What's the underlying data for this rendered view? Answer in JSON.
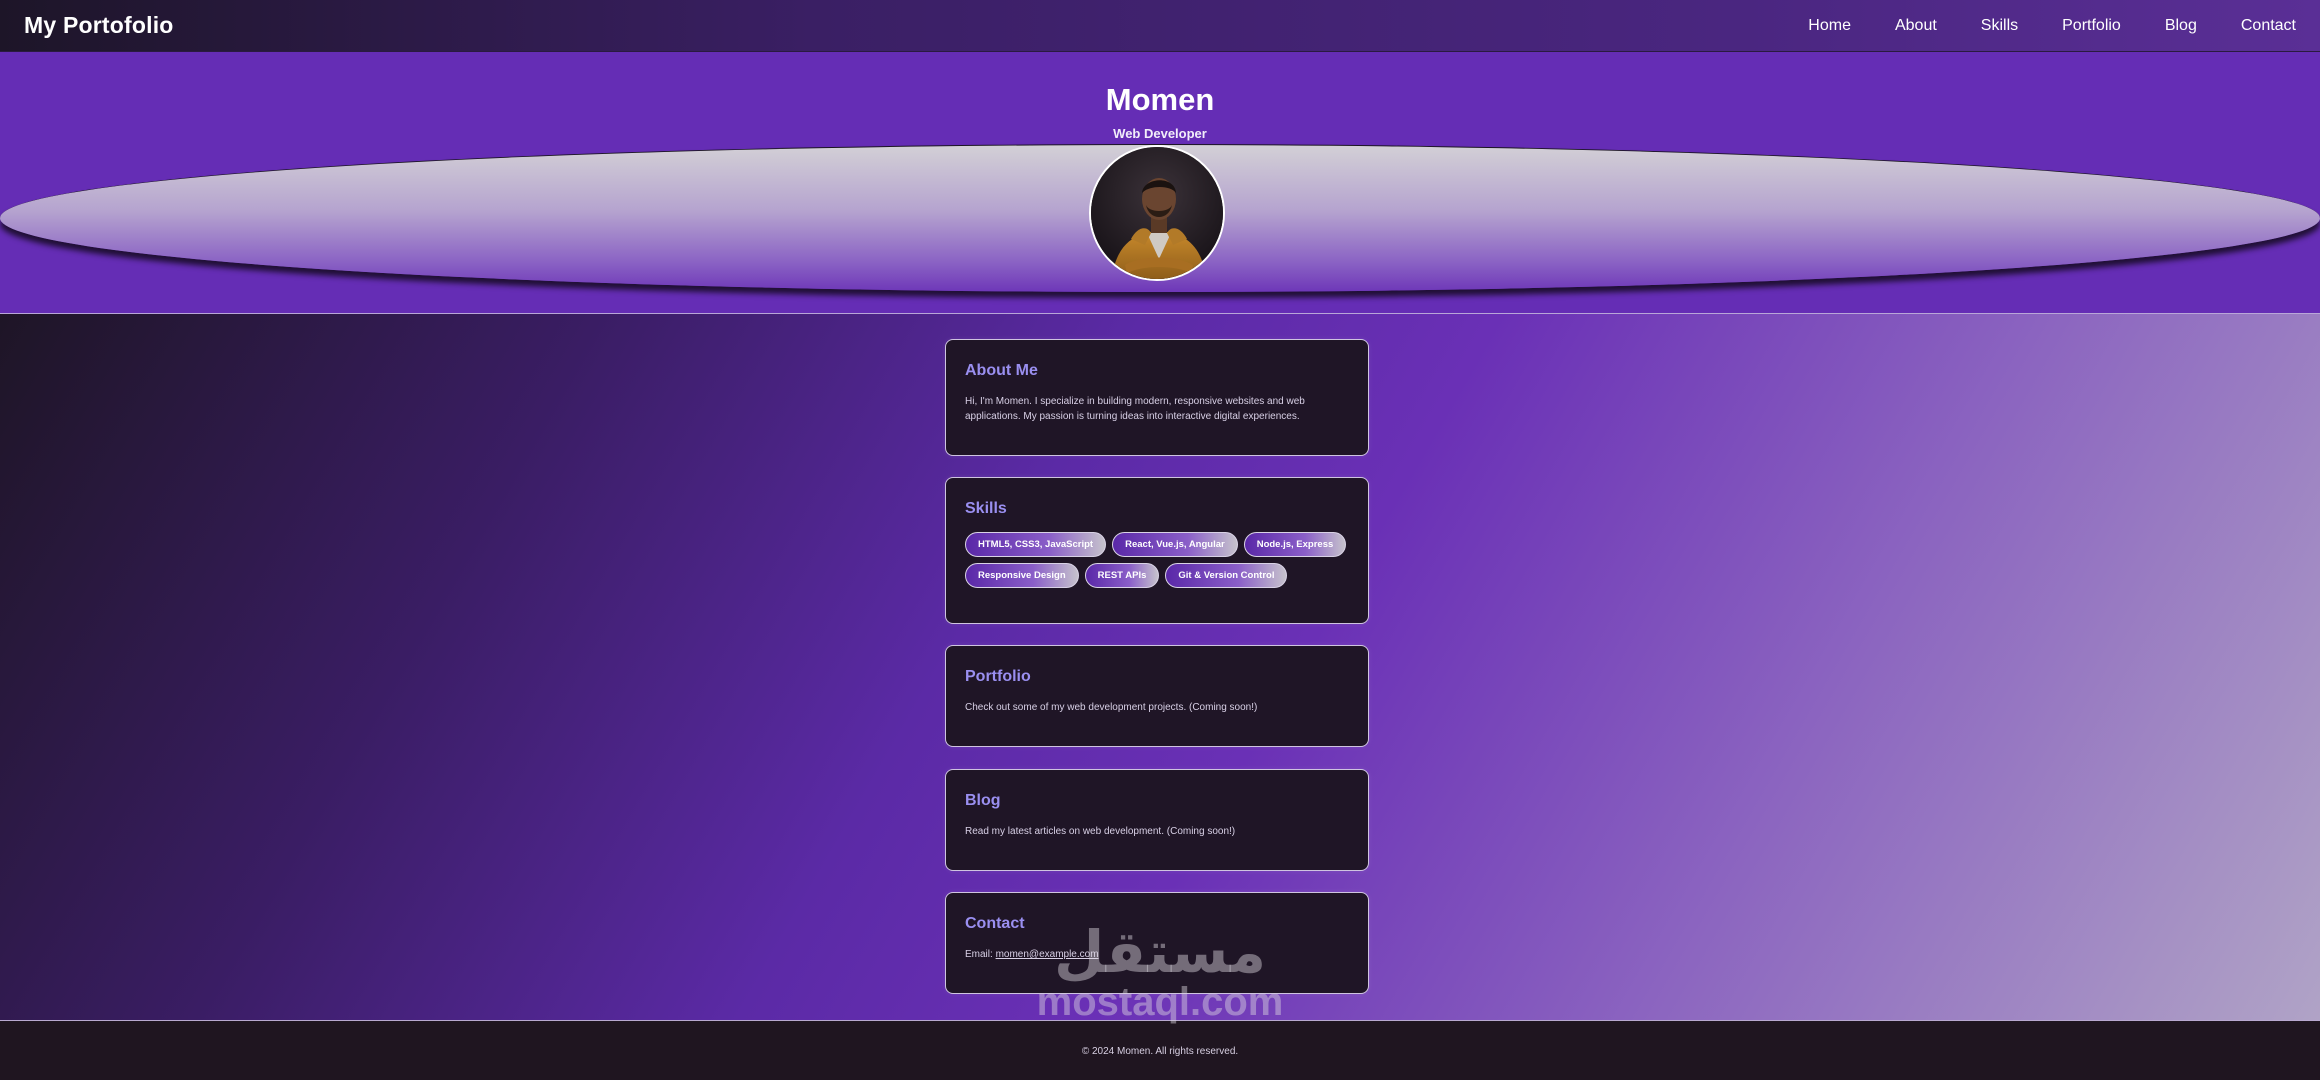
{
  "nav": {
    "brand": "My Portofolio",
    "links": [
      "Home",
      "About",
      "Skills",
      "Portfolio",
      "Blog",
      "Contact"
    ]
  },
  "hero": {
    "name": "Momen",
    "role": "Web Developer"
  },
  "sections": {
    "about": {
      "title": "About Me",
      "text": "Hi, I'm Momen. I specialize in building modern, responsive websites and web applications. My passion is turning ideas into interactive digital experiences."
    },
    "skills": {
      "title": "Skills",
      "items": [
        "HTML5, CSS3, JavaScript",
        "React, Vue.js, Angular",
        "Node.js, Express",
        "Responsive Design",
        "REST APIs",
        "Git & Version Control"
      ]
    },
    "portfolio": {
      "title": "Portfolio",
      "text": "Check out some of my web development projects. (Coming soon!)"
    },
    "blog": {
      "title": "Blog",
      "text": "Read my latest articles on web development. (Coming soon!)"
    },
    "contact": {
      "title": "Contact",
      "email_label": "Email:",
      "email": "momen@example.com"
    }
  },
  "footer": {
    "text": "© 2024 Momen. All rights reserved."
  },
  "watermark": {
    "arabic": "مستقل",
    "latin": "mostaql.com"
  },
  "colors": {
    "accent": "#652db5",
    "section_title": "#9a8ff0",
    "card_bg": "#1f1526"
  }
}
